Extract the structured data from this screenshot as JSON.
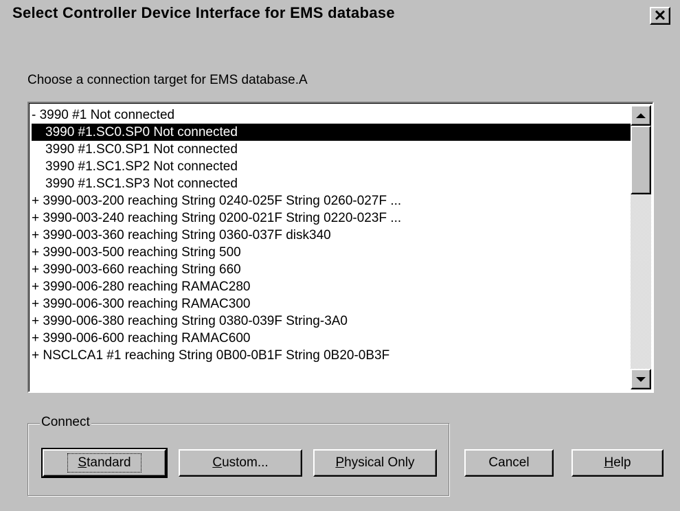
{
  "window": {
    "title": "Select Controller Device Interface for EMS database",
    "close_glyph": "✕"
  },
  "prompt": "Choose a connection target for EMS database.A",
  "list": {
    "items": [
      {
        "text": "- 3990 #1 Not connected",
        "child": false,
        "selected": false
      },
      {
        "text": "3990 #1.SC0.SP0 Not connected",
        "child": true,
        "selected": true
      },
      {
        "text": "3990 #1.SC0.SP1 Not connected",
        "child": true,
        "selected": false
      },
      {
        "text": "3990 #1.SC1.SP2 Not connected",
        "child": true,
        "selected": false
      },
      {
        "text": "3990 #1.SC1.SP3 Not connected",
        "child": true,
        "selected": false
      },
      {
        "text": "+ 3990-003-200 reaching String 0240-025F String 0260-027F ...",
        "child": false,
        "selected": false
      },
      {
        "text": "+ 3990-003-240 reaching String 0200-021F String 0220-023F ...",
        "child": false,
        "selected": false
      },
      {
        "text": "+ 3990-003-360 reaching String 0360-037F disk340",
        "child": false,
        "selected": false
      },
      {
        "text": "+ 3990-003-500 reaching String 500",
        "child": false,
        "selected": false
      },
      {
        "text": "+ 3990-003-660 reaching String 660",
        "child": false,
        "selected": false
      },
      {
        "text": "+ 3990-006-280 reaching RAMAC280",
        "child": false,
        "selected": false
      },
      {
        "text": "+ 3990-006-300 reaching RAMAC300",
        "child": false,
        "selected": false
      },
      {
        "text": "+ 3990-006-380 reaching String 0380-039F String-3A0",
        "child": false,
        "selected": false
      },
      {
        "text": "+ 3990-006-600 reaching RAMAC600",
        "child": false,
        "selected": false
      },
      {
        "text": "+ NSCLCA1 #1 reaching String 0B00-0B1F String 0B20-0B3F",
        "child": false,
        "selected": false
      }
    ]
  },
  "connect_group": {
    "label": "Connect",
    "standard": {
      "mnemonic": "S",
      "rest": "tandard"
    },
    "custom": {
      "mnemonic": "C",
      "rest": "ustom..."
    },
    "physical": {
      "mnemonic": "P",
      "rest": "hysical Only"
    }
  },
  "buttons": {
    "cancel": "Cancel",
    "help": {
      "mnemonic": "H",
      "rest": "elp"
    }
  },
  "colors": {
    "face": "#c0c0c0",
    "selection_bg": "#000000",
    "selection_fg": "#ffffff"
  },
  "icons": {
    "close": "close-icon",
    "scroll_up": "scroll-up-arrow-icon",
    "scroll_down": "scroll-down-arrow-icon"
  }
}
